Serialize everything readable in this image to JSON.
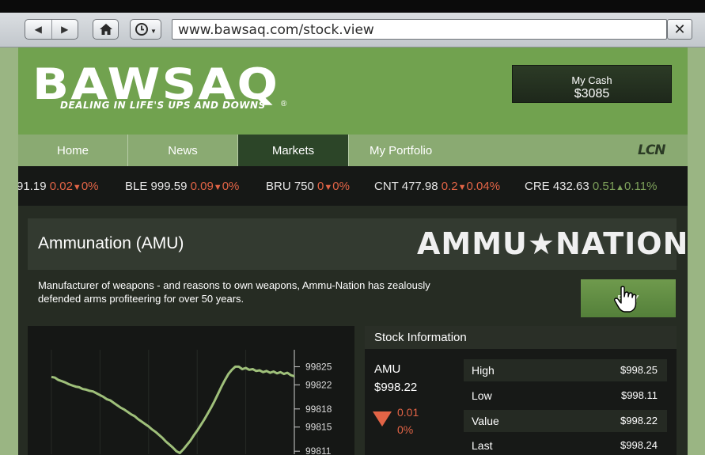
{
  "browser": {
    "url": "www.bawsaq.com/stock.view",
    "back_icon": "◀",
    "forward_icon": "▶",
    "home_icon": "home-icon",
    "history_icon": "clock-icon",
    "close_icon": "✕"
  },
  "site": {
    "logo": "BAWSAQ",
    "tagline": "DEALING IN LIFE'S UPS AND DOWNS",
    "registered_mark": "®",
    "cash_label": "My Cash",
    "cash_value": "$3085",
    "network_logo": "LCN"
  },
  "nav": {
    "tabs": [
      {
        "label": "Home",
        "active": false
      },
      {
        "label": "News",
        "active": false
      },
      {
        "label": "Markets",
        "active": true
      },
      {
        "label": "My Portfolio",
        "active": false
      }
    ]
  },
  "ticker": [
    {
      "symbol": "",
      "price": "91.19",
      "change": "0.02",
      "pct": "0%",
      "direction": "down"
    },
    {
      "symbol": "BLE",
      "price": "999.59",
      "change": "0.09",
      "pct": "0%",
      "direction": "down"
    },
    {
      "symbol": "BRU",
      "price": "750",
      "change": "0",
      "pct": "0%",
      "direction": "down"
    },
    {
      "symbol": "CNT",
      "price": "477.98",
      "change": "0.2",
      "pct": "0.04%",
      "direction": "down"
    },
    {
      "symbol": "CRE",
      "price": "432.63",
      "change": "0.51",
      "pct": "0.11%",
      "direction": "up"
    }
  ],
  "company": {
    "name": "Ammunation (AMU)",
    "brand": "AMMU★NATION",
    "description": "Manufacturer of weapons - and reasons to own weapons, Ammu-Nation has zealously defended arms profiteering for over 50 years.",
    "buy_label": "BUY"
  },
  "chart_data": {
    "type": "line",
    "title": "",
    "xlabel": "",
    "ylabel": "",
    "yticks": [
      "99825",
      "99822",
      "99818",
      "99815",
      "99811"
    ],
    "ylim": [
      99810.5,
      99826.5
    ],
    "x": [
      0,
      1,
      2,
      3,
      4,
      5,
      6,
      7,
      8,
      9,
      10,
      11,
      12,
      13,
      14,
      15,
      16,
      17,
      18,
      19,
      20,
      21,
      22,
      23,
      24,
      25,
      26,
      27,
      28,
      29,
      30,
      31,
      32,
      33,
      34,
      35,
      36,
      37,
      38,
      39,
      40,
      41,
      42,
      43,
      44,
      45,
      46,
      47,
      48,
      49,
      50,
      51,
      52,
      53,
      54,
      55,
      56,
      57,
      58,
      59,
      60,
      61,
      62,
      63,
      64,
      65,
      66,
      67,
      68,
      69,
      70
    ],
    "series": [
      {
        "values": [
          99823.3,
          99823.2,
          99822.8,
          99822.6,
          99822.4,
          99822.1,
          99821.9,
          99821.7,
          99821.6,
          99821.3,
          99821.2,
          99821.0,
          99820.9,
          99820.6,
          99820.3,
          99820.0,
          99819.6,
          99819.4,
          99819.0,
          99818.6,
          99818.2,
          99817.9,
          99817.5,
          99817.1,
          99816.8,
          99816.3,
          99815.9,
          99815.5,
          99815.1,
          99814.6,
          99814.2,
          99813.7,
          99813.2,
          99812.6,
          99812.1,
          99811.6,
          99811.0,
          99810.7,
          99811.3,
          99812.0,
          99812.7,
          99813.6,
          99814.4,
          99815.3,
          99816.2,
          99817.2,
          99818.2,
          99819.3,
          99820.5,
          99821.7,
          99822.8,
          99823.8,
          99824.5,
          99825.0,
          99825.0,
          99824.6,
          99824.8,
          99824.5,
          99824.6,
          99824.3,
          99824.4,
          99824.1,
          99824.3,
          99824.0,
          99824.2,
          99823.9,
          99824.1,
          99823.8,
          99824.0,
          99823.6,
          99823.4
        ]
      }
    ],
    "line_color": "#9fc07a",
    "grid": true
  },
  "stock_info": {
    "header": "Stock Information",
    "symbol": "AMU",
    "price": "$998.22",
    "change": "0.01",
    "change_pct": "0%",
    "rows": [
      {
        "key": "High",
        "value": "$998.25"
      },
      {
        "key": "Low",
        "value": "$998.11"
      },
      {
        "key": "Value",
        "value": "$998.22"
      },
      {
        "key": "Last",
        "value": "$998.24"
      }
    ]
  },
  "colors": {
    "header_green": "#71a24f",
    "nav_green": "#8aaa72",
    "active_tab": "#2c4528",
    "down_red": "#e26446",
    "up_green": "#7da05a"
  }
}
